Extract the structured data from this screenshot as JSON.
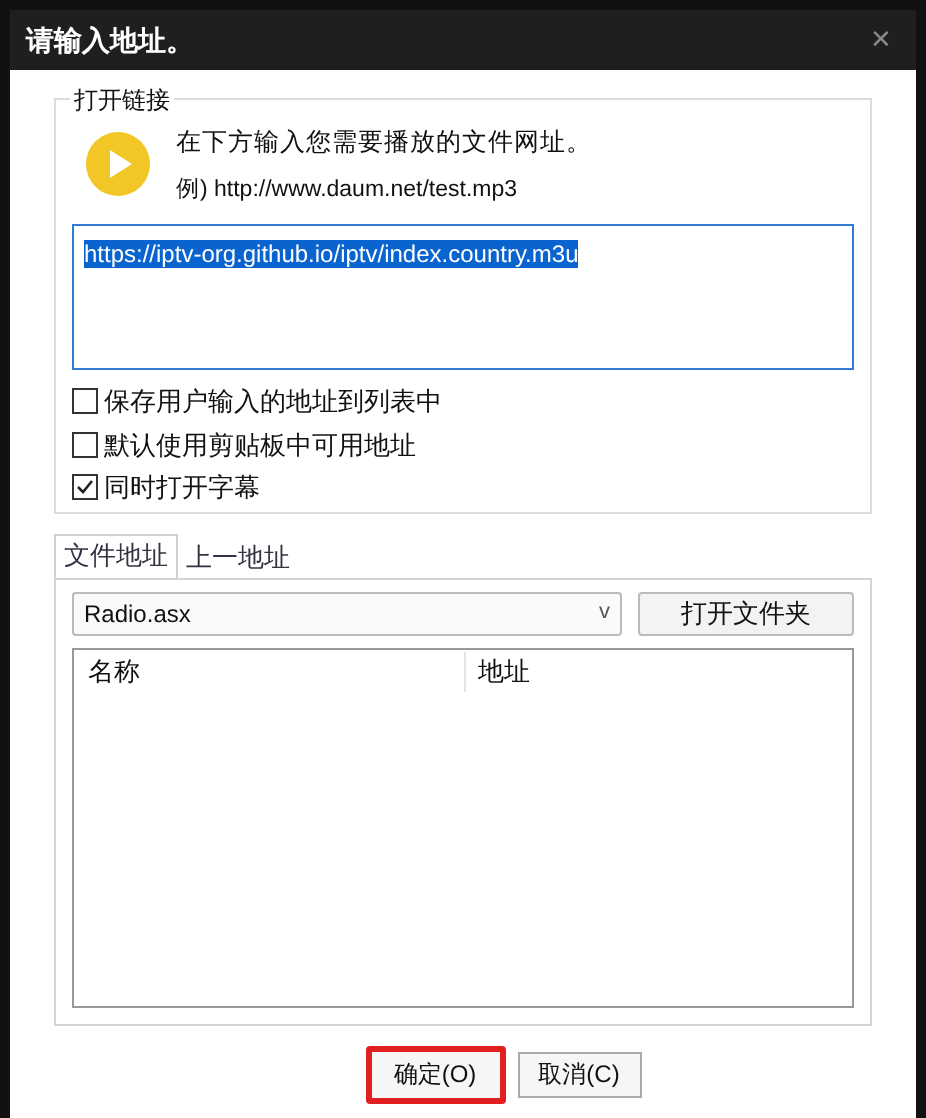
{
  "window": {
    "title": "请输入地址。",
    "close": "✕"
  },
  "link_group": {
    "title": "打开链接",
    "instruction": "在下方输入您需要播放的文件网址。",
    "example": "例) http://www.daum.net/test.mp3",
    "url_value": "https://iptv-org.github.io/iptv/index.country.m3u",
    "options": [
      {
        "label": "保存用户输入的地址到列表中",
        "checked": false
      },
      {
        "label": "默认使用剪贴板中可用地址",
        "checked": false
      },
      {
        "label": "同时打开字幕",
        "checked": true
      }
    ]
  },
  "tabs": [
    {
      "label": "文件地址",
      "selected": true
    },
    {
      "label": "上一地址",
      "selected": false
    }
  ],
  "file_select": {
    "value": "Radio.asx",
    "arrow": "v"
  },
  "open_folder_button": "打开文件夹",
  "table": {
    "columns": [
      "名称",
      "地址"
    ]
  },
  "buttons": [
    {
      "label": "确定(O)",
      "highlighted": true
    },
    {
      "label": "取消(C)",
      "highlighted": false
    }
  ]
}
